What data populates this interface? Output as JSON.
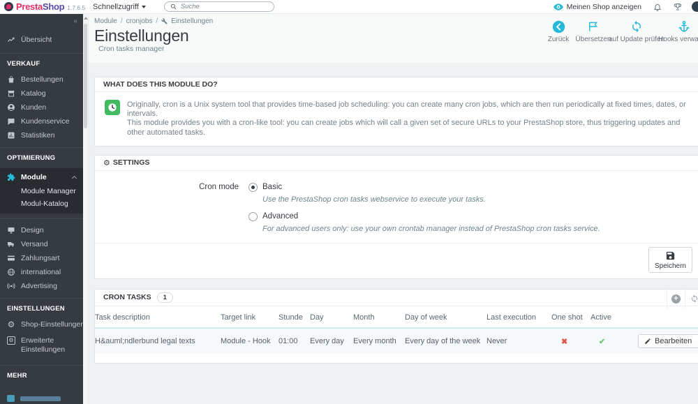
{
  "icons": {
    "gear": "⚙",
    "collapse": "«",
    "separator": "/",
    "plus": "+"
  },
  "topbar": {
    "brand_presta": "Presta",
    "brand_shop": "Shop",
    "version": "1.7.6.5",
    "quick_access": "Schnellzugriff",
    "search_placeholder": "Suche",
    "view_shop": "Meinen Shop anzeigen"
  },
  "sidebar": {
    "overview": "Übersicht",
    "sections": [
      {
        "title": "VERKAUF",
        "items": [
          {
            "label": "Bestellungen"
          },
          {
            "label": "Katalog"
          },
          {
            "label": "Kunden"
          },
          {
            "label": "Kundenservice"
          },
          {
            "label": "Statistiken"
          }
        ]
      },
      {
        "title": "OPTIMIERUNG",
        "items": [
          {
            "label": "Module",
            "active": true,
            "children": [
              {
                "label": "Module Manager"
              },
              {
                "label": "Modul-Katalog"
              }
            ]
          },
          {
            "label": "Design"
          },
          {
            "label": "Versand"
          },
          {
            "label": "Zahlungsart"
          },
          {
            "label": "international"
          },
          {
            "label": "Advertising"
          }
        ]
      },
      {
        "title": "EINSTELLUNGEN",
        "items": [
          {
            "label": "Shop-Einstellungen"
          },
          {
            "label": "Erweiterte Einstellungen"
          }
        ]
      },
      {
        "title": "MEHR",
        "items": []
      }
    ]
  },
  "page_header": {
    "breadcrumb": {
      "level1": "Module",
      "level2": "cronjobs",
      "level3": "Einstellungen"
    },
    "title": "Einstellungen",
    "subtitle": "Cron tasks manager",
    "actions": {
      "back": "Zurück",
      "translate": "Übersetzen",
      "check_update": "auf Update prüfen",
      "manage_hooks": "Hooks verwalten"
    }
  },
  "module_info": {
    "title": "WHAT DOES THIS MODULE DO?",
    "line1": "Originally, cron is a Unix system tool that provides time-based job scheduling: you can create many cron jobs, which are then run periodically at fixed times, dates, or intervals.",
    "line2": "This module provides you with a cron-like tool: you can create jobs which will call a given set of secure URLs to your PrestaShop store, thus triggering updates and other automated tasks."
  },
  "settings": {
    "title": "SETTINGS",
    "cron_mode_label": "Cron mode",
    "basic": {
      "label": "Basic",
      "help": "Use the PrestaShop cron tasks webservice to execute your tasks.",
      "selected": true
    },
    "advanced": {
      "label": "Advanced",
      "help": "For advanced users only: use your own crontab manager instead of PrestaShop cron tasks service.",
      "selected": false
    },
    "save_label": "Speichern"
  },
  "cron_tasks": {
    "title": "CRON TASKS",
    "count": "1",
    "columns": {
      "task": "Task description",
      "target": "Target link",
      "hour": "Stunde",
      "day": "Day",
      "month": "Month",
      "day_of_week": "Day of week",
      "last_execution": "Last execution",
      "one_shot": "One shot",
      "active": "Active"
    },
    "rows": [
      {
        "task": "H&auml;ndlerbund legal texts",
        "target": "Module - Hook",
        "hour": "01:00",
        "day": "Every day",
        "month": "Every month",
        "day_of_week": "Every day of the week",
        "last_execution": "Never",
        "one_shot_icon": "✖",
        "active_icon": "✔",
        "edit_label": "Bearbeiten"
      }
    ]
  },
  "colors": {
    "accent": "#25b9d7",
    "success": "#72c279",
    "danger": "#e2574c",
    "brand_pink": "#e42e63",
    "brand_purple": "#5948a6",
    "module_icon_green": "#41ba61",
    "sidebar_bg": "#363a41"
  }
}
